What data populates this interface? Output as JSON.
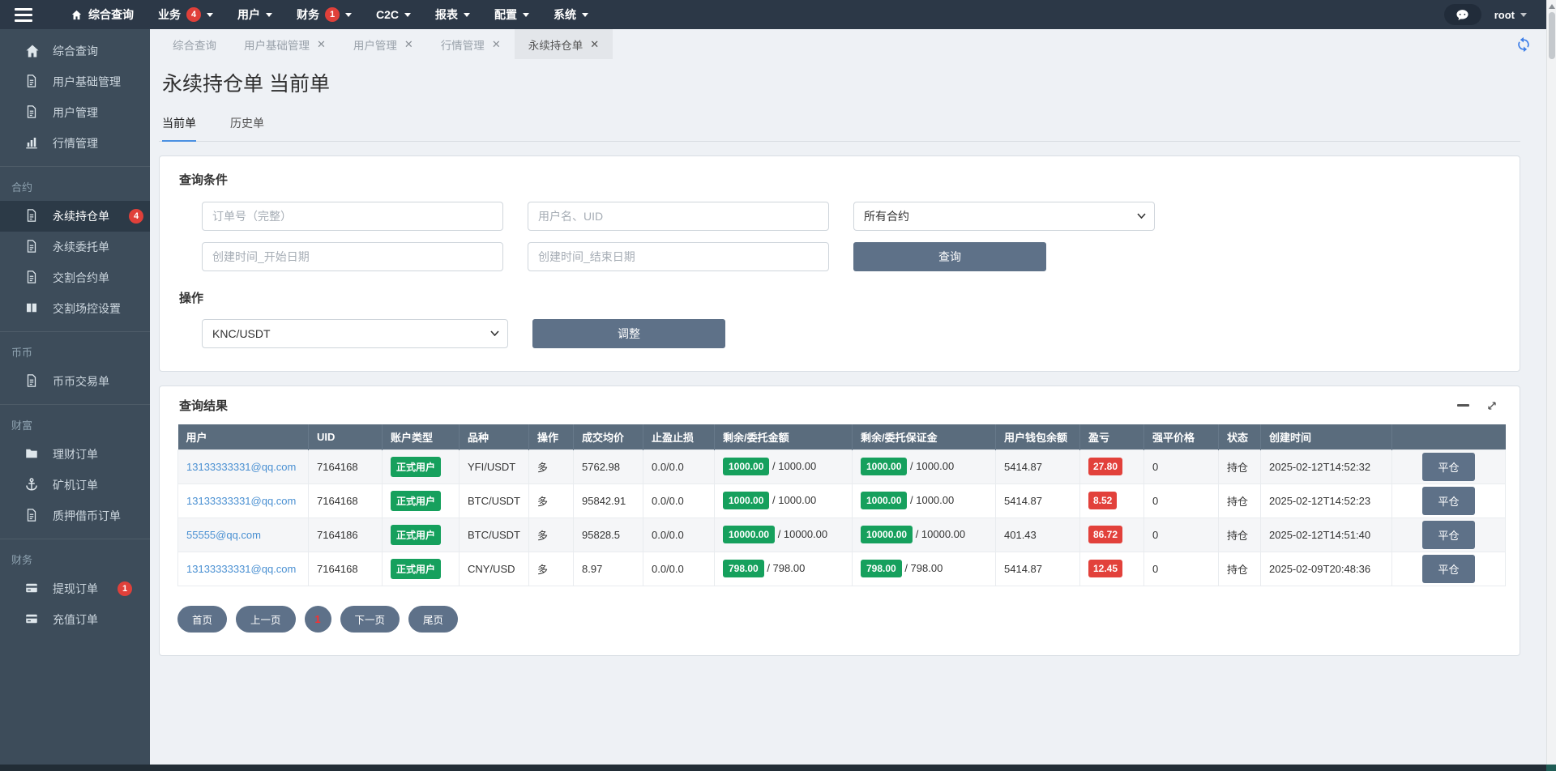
{
  "navbar": {
    "menu": [
      {
        "label": "综合查询"
      },
      {
        "label": "业务",
        "badge": "4"
      },
      {
        "label": "用户"
      },
      {
        "label": "财务",
        "badge": "1"
      },
      {
        "label": "C2C"
      },
      {
        "label": "报表"
      },
      {
        "label": "配置"
      },
      {
        "label": "系统"
      }
    ],
    "user": "root"
  },
  "sidebar": {
    "sections": [
      {
        "header": "",
        "items": [
          {
            "label": "综合查询"
          },
          {
            "label": "用户基础管理"
          },
          {
            "label": "用户管理"
          },
          {
            "label": "行情管理"
          }
        ]
      },
      {
        "header": "合约",
        "items": [
          {
            "label": "永续持仓单",
            "badge": "4"
          },
          {
            "label": "永续委托单"
          },
          {
            "label": "交割合约单"
          },
          {
            "label": "交割场控设置"
          }
        ]
      },
      {
        "header": "币币",
        "items": [
          {
            "label": "币币交易单"
          }
        ]
      },
      {
        "header": "财富",
        "items": [
          {
            "label": "理财订单"
          },
          {
            "label": "矿机订单"
          },
          {
            "label": "质押借币订单"
          }
        ]
      },
      {
        "header": "财务",
        "items": [
          {
            "label": "提现订单",
            "badge": "1"
          },
          {
            "label": "充值订单"
          }
        ]
      }
    ]
  },
  "chrome_tabs": [
    {
      "label": "综合查询"
    },
    {
      "label": "用户基础管理"
    },
    {
      "label": "用户管理"
    },
    {
      "label": "行情管理"
    },
    {
      "label": "永续持仓单"
    }
  ],
  "page": {
    "title": "永续持仓单 当前单",
    "subtabs": [
      {
        "label": "当前单"
      },
      {
        "label": "历史单"
      }
    ]
  },
  "query": {
    "section_title": "查询条件",
    "order_placeholder": "订单号（完整）",
    "user_placeholder": "用户名、UID",
    "contract_select": "所有合约",
    "start_placeholder": "创建时间_开始日期",
    "end_placeholder": "创建时间_结束日期",
    "search_label": "查询",
    "op_title": "操作",
    "pair_select": "KNC/USDT",
    "adjust_label": "调整"
  },
  "results": {
    "title": "查询结果",
    "columns": [
      "用户",
      "UID",
      "账户类型",
      "品种",
      "操作",
      "成交均价",
      "止盈止损",
      "剩余/委托金额",
      "剩余/委托保证金",
      "用户钱包余额",
      "盈亏",
      "强平价格",
      "状态",
      "创建时间",
      ""
    ],
    "rows": [
      {
        "user": "13133333331@qq.com",
        "uid": "7164168",
        "account_type": "正式用户",
        "symbol": "YFI/USDT",
        "side": "多",
        "avg_price": "5762.98",
        "tp_sl": "0.0/0.0",
        "amount_remain": "1000.00",
        "amount_total": "/ 1000.00",
        "margin_remain": "1000.00",
        "margin_total": "/ 1000.00",
        "wallet": "5414.87",
        "pnl": "27.80",
        "liq_price": "0",
        "status": "持仓",
        "created": "2025-02-12T14:52:32",
        "action": "平仓"
      },
      {
        "user": "13133333331@qq.com",
        "uid": "7164168",
        "account_type": "正式用户",
        "symbol": "BTC/USDT",
        "side": "多",
        "avg_price": "95842.91",
        "tp_sl": "0.0/0.0",
        "amount_remain": "1000.00",
        "amount_total": "/ 1000.00",
        "margin_remain": "1000.00",
        "margin_total": "/ 1000.00",
        "wallet": "5414.87",
        "pnl": "8.52",
        "liq_price": "0",
        "status": "持仓",
        "created": "2025-02-12T14:52:23",
        "action": "平仓"
      },
      {
        "user": "55555@qq.com",
        "uid": "7164186",
        "account_type": "正式用户",
        "symbol": "BTC/USDT",
        "side": "多",
        "avg_price": "95828.5",
        "tp_sl": "0.0/0.0",
        "amount_remain": "10000.00",
        "amount_total": "/ 10000.00",
        "margin_remain": "10000.00",
        "margin_total": "/ 10000.00",
        "wallet": "401.43",
        "pnl": "86.72",
        "liq_price": "0",
        "status": "持仓",
        "created": "2025-02-12T14:51:40",
        "action": "平仓"
      },
      {
        "user": "13133333331@qq.com",
        "uid": "7164168",
        "account_type": "正式用户",
        "symbol": "CNY/USD",
        "side": "多",
        "avg_price": "8.97",
        "tp_sl": "0.0/0.0",
        "amount_remain": "798.00",
        "amount_total": "/ 798.00",
        "margin_remain": "798.00",
        "margin_total": "/ 798.00",
        "wallet": "5414.87",
        "pnl": "12.45",
        "liq_price": "0",
        "status": "持仓",
        "created": "2025-02-09T20:48:36",
        "action": "平仓"
      }
    ]
  },
  "pagination": {
    "first": "首页",
    "prev": "上一页",
    "current": "1",
    "next": "下一页",
    "last": "尾页"
  },
  "colors": {
    "green_badge": "#16a05d",
    "red_badge": "#e2413b",
    "slate_button": "#5e7188",
    "link_blue": "#4a90d2",
    "active_subtab_underline": "#4a90e2",
    "nav_badge_red": "#e0403a",
    "refresh_icon_blue": "#3e7fe8",
    "table_header_bg": "#5a6c7d",
    "navbar_bg": "#2c3847",
    "sidebar_bg": "#3d4c5a"
  }
}
